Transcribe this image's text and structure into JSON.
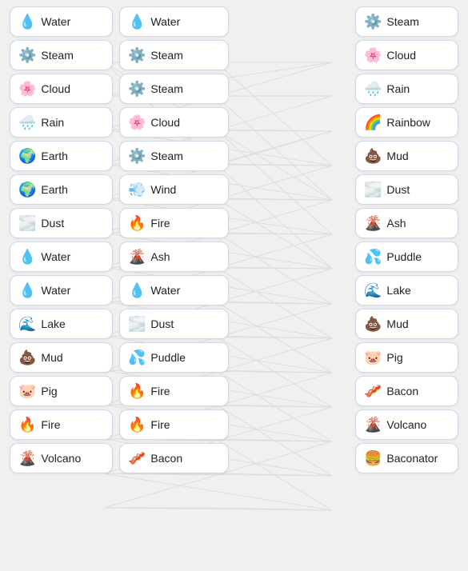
{
  "columns": {
    "left": [
      {
        "emoji": "💧",
        "label": "Water"
      },
      {
        "emoji": "⚙️",
        "label": "Steam"
      },
      {
        "emoji": "🌸",
        "label": "Cloud"
      },
      {
        "emoji": "🌧️",
        "label": "Rain"
      },
      {
        "emoji": "🌍",
        "label": "Earth"
      },
      {
        "emoji": "🌍",
        "label": "Earth"
      },
      {
        "emoji": "🌫️",
        "label": "Dust"
      },
      {
        "emoji": "💧",
        "label": "Water"
      },
      {
        "emoji": "💧",
        "label": "Water"
      },
      {
        "emoji": "🌊",
        "label": "Lake"
      },
      {
        "emoji": "💩",
        "label": "Mud"
      },
      {
        "emoji": "🐷",
        "label": "Pig"
      },
      {
        "emoji": "🔥",
        "label": "Fire"
      },
      {
        "emoji": "🌋",
        "label": "Volcano"
      }
    ],
    "mid": [
      {
        "emoji": "💧",
        "label": "Water"
      },
      {
        "emoji": "⚙️",
        "label": "Steam"
      },
      {
        "emoji": "⚙️",
        "label": "Steam"
      },
      {
        "emoji": "🌸",
        "label": "Cloud"
      },
      {
        "emoji": "⚙️",
        "label": "Steam"
      },
      {
        "emoji": "💨",
        "label": "Wind"
      },
      {
        "emoji": "🔥",
        "label": "Fire"
      },
      {
        "emoji": "🌋",
        "label": "Ash"
      },
      {
        "emoji": "💧",
        "label": "Water"
      },
      {
        "emoji": "🌫️",
        "label": "Dust"
      },
      {
        "emoji": "💦",
        "label": "Puddle"
      },
      {
        "emoji": "🔥",
        "label": "Fire"
      },
      {
        "emoji": "🔥",
        "label": "Fire"
      },
      {
        "emoji": "🥓",
        "label": "Bacon"
      }
    ],
    "right": [
      {
        "emoji": "⚙️",
        "label": "Steam"
      },
      {
        "emoji": "🌸",
        "label": "Cloud"
      },
      {
        "emoji": "🌧️",
        "label": "Rain"
      },
      {
        "emoji": "🌈",
        "label": "Rainbow"
      },
      {
        "emoji": "💩",
        "label": "Mud"
      },
      {
        "emoji": "🌫️",
        "label": "Dust"
      },
      {
        "emoji": "🌋",
        "label": "Ash"
      },
      {
        "emoji": "💦",
        "label": "Puddle"
      },
      {
        "emoji": "🌊",
        "label": "Lake"
      },
      {
        "emoji": "💩",
        "label": "Mud"
      },
      {
        "emoji": "🐷",
        "label": "Pig"
      },
      {
        "emoji": "🥓",
        "label": "Bacon"
      },
      {
        "emoji": "🌋",
        "label": "Volcano"
      },
      {
        "emoji": "🍔",
        "label": "Baconator"
      }
    ]
  }
}
